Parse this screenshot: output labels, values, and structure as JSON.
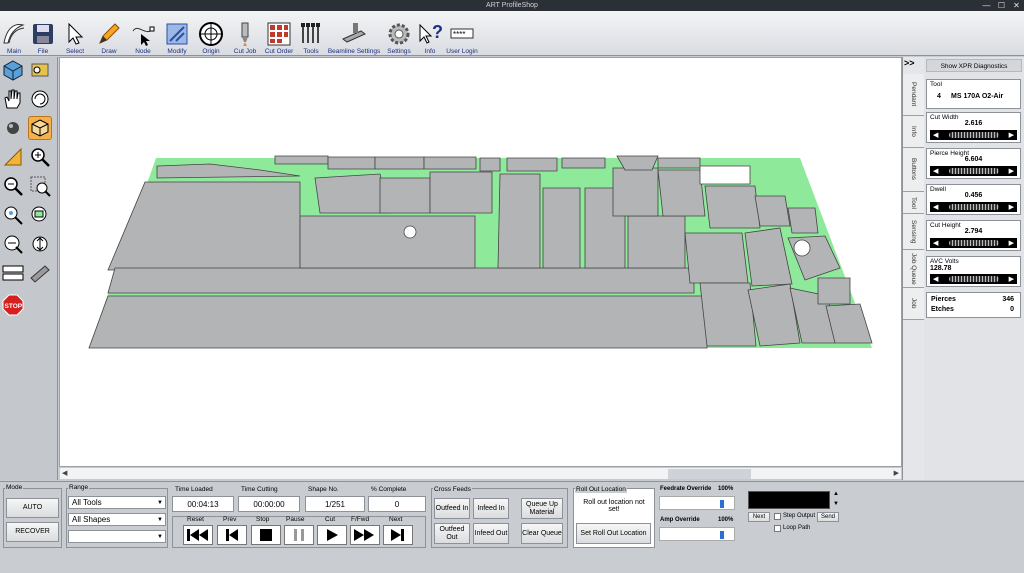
{
  "window": {
    "title": "ART ProfileShop",
    "minimize": "—",
    "maximize": "☐",
    "close": "✕"
  },
  "toolbar": [
    {
      "name": "main",
      "label": "Main"
    },
    {
      "name": "file",
      "label": "File"
    },
    {
      "name": "select",
      "label": "Select"
    },
    {
      "name": "draw",
      "label": "Draw"
    },
    {
      "name": "node",
      "label": "Node"
    },
    {
      "name": "modify",
      "label": "Modify"
    },
    {
      "name": "origin",
      "label": "Origin"
    },
    {
      "name": "cut-job",
      "label": "Cut Job"
    },
    {
      "name": "cut-order",
      "label": "Cut Order"
    },
    {
      "name": "tools",
      "label": "Tools"
    },
    {
      "name": "beamline-settings",
      "label": "Beamline Settings"
    },
    {
      "name": "settings",
      "label": "Settings"
    },
    {
      "name": "info",
      "label": "Info"
    },
    {
      "name": "user-login",
      "label": "User Login"
    }
  ],
  "right_panel": {
    "expand": ">>",
    "show_xpr": "Show XPR Diagnostics",
    "tabs": [
      "Pendant",
      "Info",
      "Buttons",
      "Tool",
      "Sensing",
      "Job Queue",
      "Job"
    ],
    "tool": {
      "caption": "Tool",
      "number": "4",
      "name": "MS 170A O2-Air"
    },
    "cut_width": {
      "caption": "Cut Width",
      "value": "2.616"
    },
    "pierce_height": {
      "caption": "Pierce Height",
      "value": "6.604"
    },
    "dwell": {
      "caption": "Dwell",
      "value": "0.456"
    },
    "cut_height": {
      "caption": "Cut Height",
      "value": "2.794"
    },
    "avc_volts": {
      "caption": "AVC Volts",
      "value": "128.78"
    },
    "pierces": {
      "label": "Pierces",
      "value": "346"
    },
    "etches": {
      "label": "Etches",
      "value": "0"
    }
  },
  "bottom": {
    "mode": {
      "caption": "Mode",
      "auto": "AUTO",
      "recover": "RECOVER"
    },
    "range": {
      "caption": "Range",
      "tools": "All Tools",
      "shapes": "All Shapes",
      "third": ""
    },
    "time_loaded": {
      "caption": "Time Loaded",
      "value": "00:04:13"
    },
    "time_cutting": {
      "caption": "Time Cutting",
      "value": "00:00:00"
    },
    "shape_no": {
      "caption": "Shape No.",
      "value": "1/251"
    },
    "percent_complete": {
      "caption": "% Complete",
      "value": "0"
    },
    "controls": [
      {
        "name": "reset",
        "label": "Reset"
      },
      {
        "name": "prev",
        "label": "Prev"
      },
      {
        "name": "stop",
        "label": "Stop"
      },
      {
        "name": "pause",
        "label": "Pause"
      },
      {
        "name": "cut",
        "label": "Cut"
      },
      {
        "name": "ffwd",
        "label": "F/Fwd"
      },
      {
        "name": "next",
        "label": "Next"
      }
    ],
    "cross_feeds": {
      "caption": "Cross Feeds",
      "outfeed_in": "Outfeed In",
      "infeed_in": "Infeed In",
      "queue_up": "Queue Up Material",
      "outfeed_out": "Outfeed Out",
      "infeed_out": "Infeed Out",
      "clear_queue": "Clear Queue"
    },
    "roll_out": {
      "caption": "Roll Out Location",
      "message": "Roll out location not set!",
      "set_button": "Set Roll Out Location"
    },
    "feedrate": {
      "label": "Feedrate Override",
      "value": "100%",
      "fraction": 0.85
    },
    "amp": {
      "label": "Amp Override",
      "value": "100%",
      "fraction": 0.85
    },
    "next_btn": "Next",
    "step_output": "Step Output",
    "send": "Send",
    "loop_path": "Loop Path"
  },
  "colors": {
    "sheet": "#8fe99a",
    "part": "#b3b4b6",
    "active_tool": "#f4b04b",
    "bar_dark": "#2b2f36"
  }
}
